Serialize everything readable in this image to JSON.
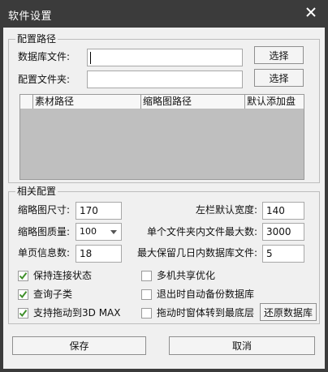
{
  "window": {
    "title": "软件设置",
    "close_label": "✕"
  },
  "config_paths": {
    "group_title": "配置路径",
    "db_file_label": "数据库文件:",
    "db_file_value": "",
    "config_folder_label": "配置文件夹:",
    "config_folder_value": "",
    "choose_label": "选择",
    "table_columns": [
      "素材路径",
      "缩略图路径",
      "默认添加盘"
    ]
  },
  "related": {
    "group_title": "相关配置",
    "thumb_size_label": "缩略图尺寸:",
    "thumb_size_value": "170",
    "thumb_quality_label": "缩略图质量:",
    "thumb_quality_value": "100",
    "page_count_label": "单页信息数:",
    "page_count_value": "18",
    "sidebar_width_label": "左栏默认宽度:",
    "sidebar_width_value": "140",
    "max_files_label": "单个文件夹内文件最大数:",
    "max_files_value": "3000",
    "keep_days_label": "最大保留几日内数据库文件:",
    "keep_days_value": "5",
    "checks": [
      {
        "label": "保持连接状态",
        "checked": true
      },
      {
        "label": "查询子类",
        "checked": true
      },
      {
        "label": "支持拖动到3D MAX",
        "checked": true
      },
      {
        "label": "多机共享优化",
        "checked": false
      },
      {
        "label": "退出时自动备份数据库",
        "checked": false
      },
      {
        "label": "拖动时窗体转到最底层",
        "checked": false
      }
    ],
    "restore_label": "还原数据库"
  },
  "footer": {
    "save_label": "保存",
    "cancel_label": "取消"
  },
  "colors": {
    "title_bar": "#3b3b3b",
    "check_mark": "#3f8f2a"
  }
}
